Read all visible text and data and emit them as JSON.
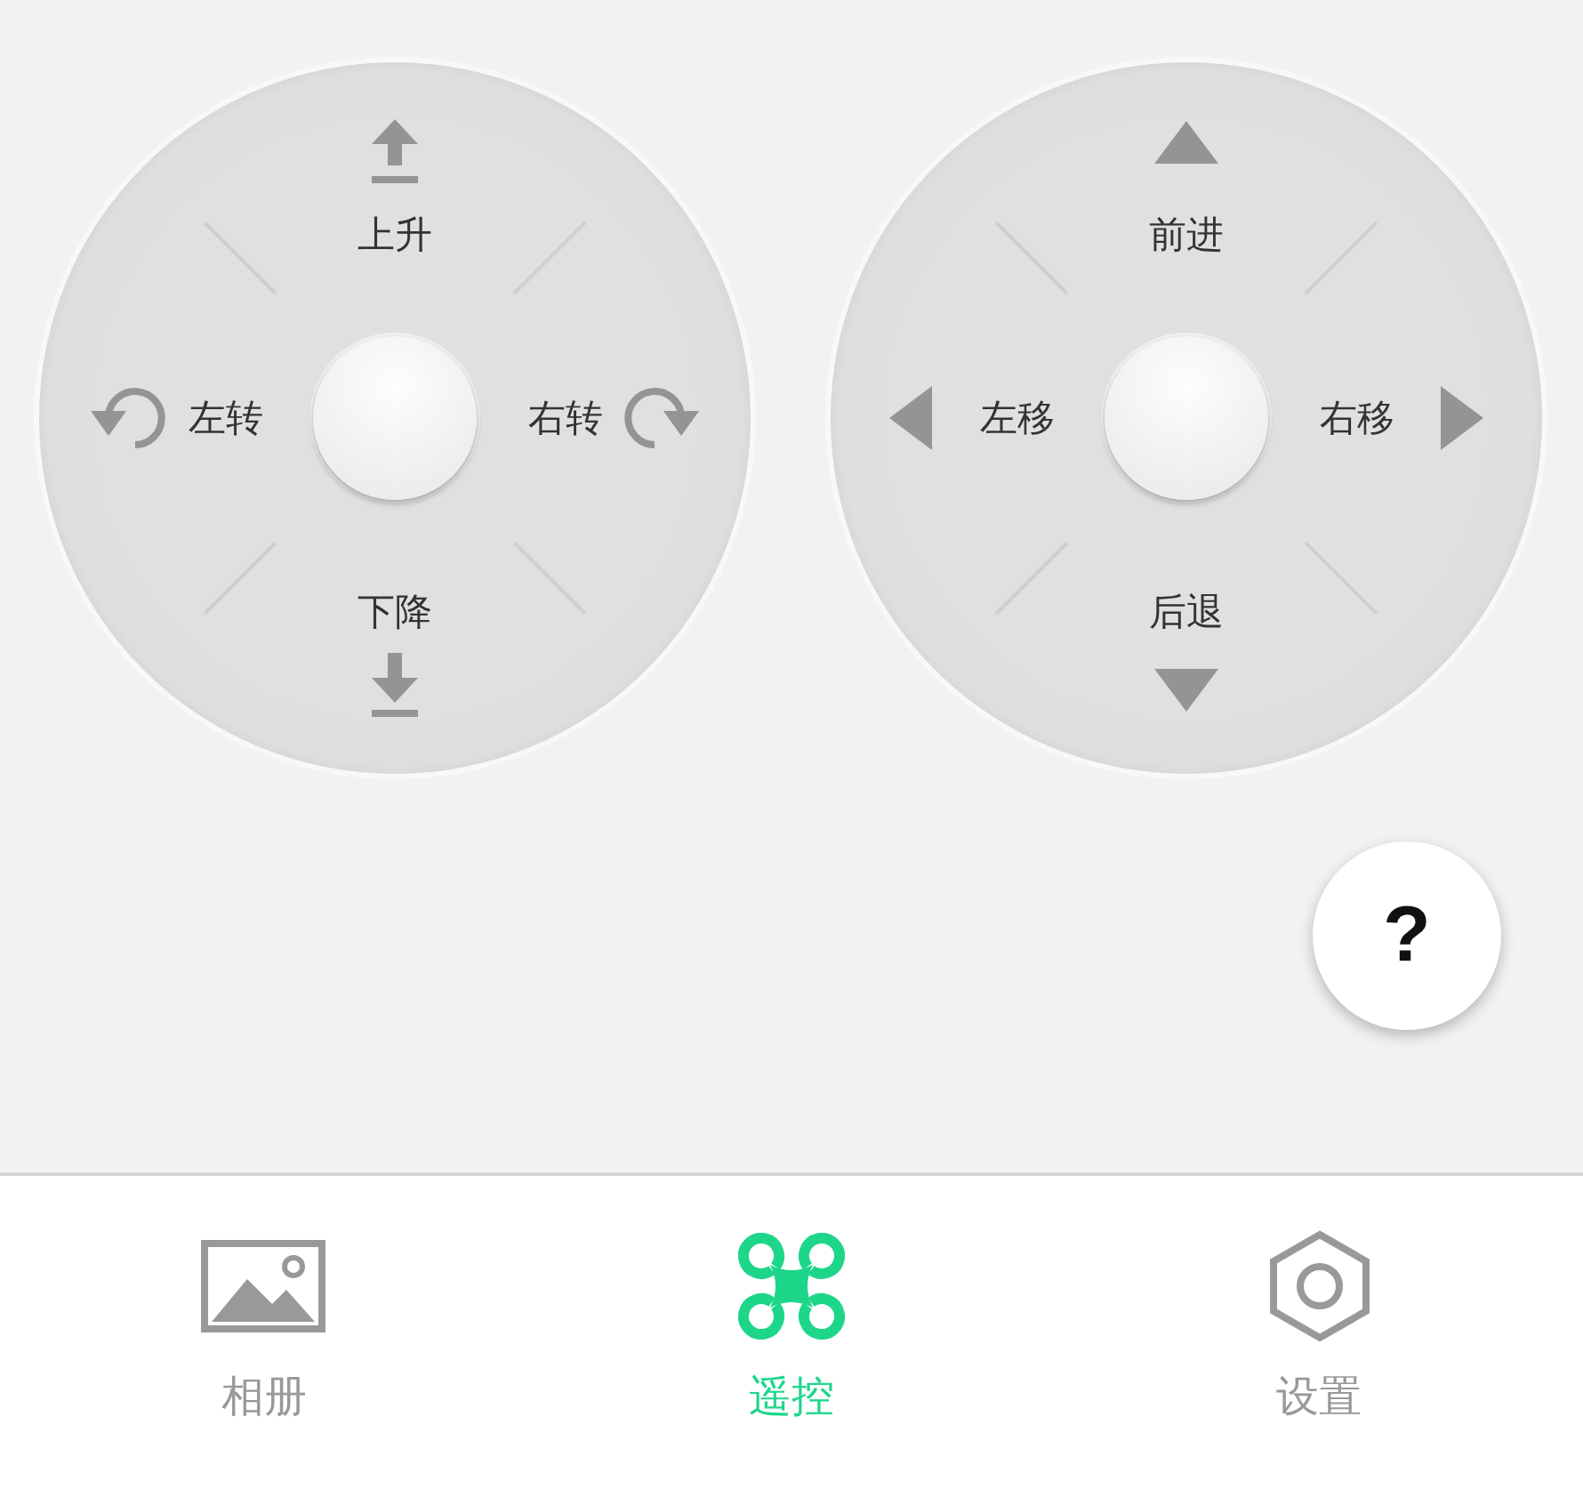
{
  "pads": [
    {
      "kind": "altitude",
      "directions": [
        {
          "label": "上升"
        },
        {
          "label": "左转"
        },
        {
          "label": "右转"
        },
        {
          "label": "下降"
        }
      ]
    },
    {
      "kind": "movement",
      "directions": [
        {
          "label": "前进"
        },
        {
          "label": "左移"
        },
        {
          "label": "右移"
        },
        {
          "label": "后退"
        }
      ]
    }
  ],
  "help_button": {
    "label": "?"
  },
  "bottom_nav": [
    {
      "label": "相册",
      "kind": "album",
      "selected": false
    },
    {
      "label": "遥控",
      "kind": "remote",
      "selected": true
    },
    {
      "label": "设置",
      "kind": "settings",
      "selected": false
    }
  ]
}
